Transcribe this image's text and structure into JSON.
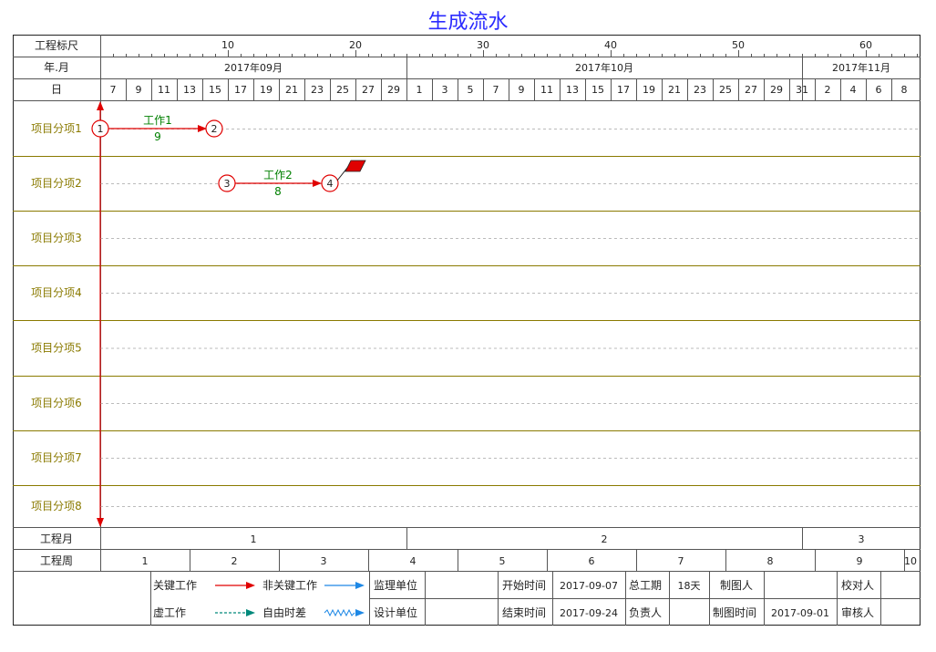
{
  "title": "生成流水",
  "header_labels": {
    "ruler": "工程标尺",
    "yearmonth": "年.月",
    "day": "日",
    "proj_month": "工程月",
    "proj_week": "工程周"
  },
  "ruler_ticks": [
    "10",
    "20",
    "30",
    "40",
    "50",
    "60"
  ],
  "months": [
    "2017年09月",
    "2017年10月",
    "2017年11月"
  ],
  "days": [
    "7",
    "9",
    "11",
    "13",
    "15",
    "17",
    "19",
    "21",
    "23",
    "25",
    "27",
    "29",
    "1",
    "3",
    "5",
    "7",
    "9",
    "11",
    "13",
    "15",
    "17",
    "19",
    "21",
    "23",
    "25",
    "27",
    "29",
    "31",
    "2",
    "4",
    "6",
    "8"
  ],
  "rows": [
    "项目分项1",
    "项目分项2",
    "项目分项3",
    "项目分项4",
    "项目分项5",
    "项目分项6",
    "项目分项7",
    "项目分项8"
  ],
  "nodes": [
    "1",
    "2",
    "3",
    "4"
  ],
  "works": [
    {
      "name": "工作1",
      "duration": "9"
    },
    {
      "name": "工作2",
      "duration": "8"
    }
  ],
  "project_months": [
    "1",
    "2",
    "3"
  ],
  "project_weeks": [
    "1",
    "2",
    "3",
    "4",
    "5",
    "6",
    "7",
    "8",
    "9",
    "10"
  ],
  "legend": {
    "critical": "关键工作",
    "noncritical": "非关键工作",
    "dummy": "虚工作",
    "free_float": "自由时差"
  },
  "info": {
    "supervisor_label": "监理单位",
    "designer_label": "设计单位",
    "start_label": "开始时间",
    "start_value": "2017-09-07",
    "end_label": "结束时间",
    "end_value": "2017-09-24",
    "duration_label": "总工期",
    "duration_value": "18天",
    "owner_label": "负责人",
    "drafter_label": "制图人",
    "draw_time_label": "制图时间",
    "draw_time_value": "2017-09-01",
    "proofreader_label": "校对人",
    "reviewer_label": "审核人"
  },
  "colors": {
    "critical": "#e00000",
    "noncritical": "#1e88e5",
    "dummy": "#00897b",
    "free_float": "#1e88e5",
    "row_line": "#8a7a00",
    "title": "#2b2bff"
  }
}
